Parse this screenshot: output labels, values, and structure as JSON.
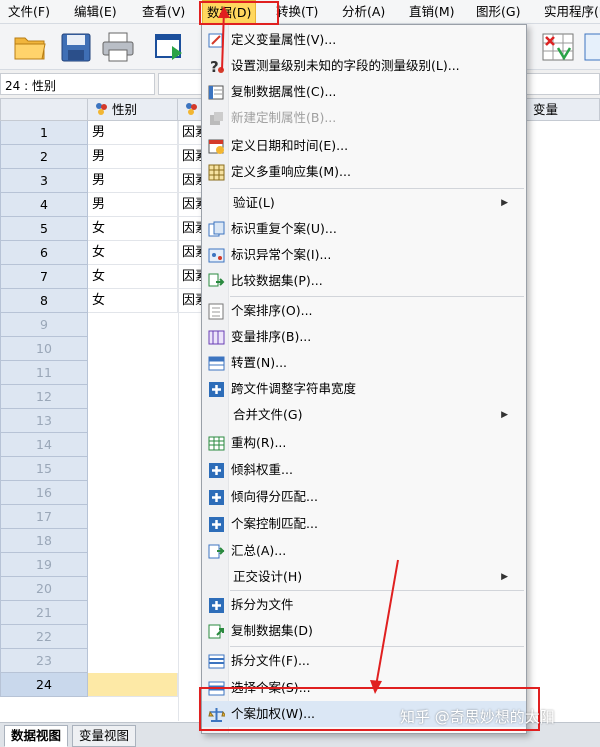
{
  "menubar": {
    "items": [
      {
        "label": "文件(F)"
      },
      {
        "label": "编辑(E)"
      },
      {
        "label": "查看(V)"
      },
      {
        "label": "数据(D)"
      },
      {
        "label": "转换(T)"
      },
      {
        "label": "分析(A)"
      },
      {
        "label": "直销(M)"
      },
      {
        "label": "图形(G)"
      },
      {
        "label": "实用程序(U)"
      }
    ]
  },
  "cellref": {
    "value": "24 : 性别"
  },
  "grid": {
    "columns": [
      "性别",
      "因素",
      "变量"
    ],
    "rows": [
      {
        "num": "1",
        "sex": "男",
        "factor": "因素"
      },
      {
        "num": "2",
        "sex": "男",
        "factor": "因素"
      },
      {
        "num": "3",
        "sex": "男",
        "factor": "因素"
      },
      {
        "num": "4",
        "sex": "男",
        "factor": "因素"
      },
      {
        "num": "5",
        "sex": "女",
        "factor": "因素"
      },
      {
        "num": "6",
        "sex": "女",
        "factor": "因素"
      },
      {
        "num": "7",
        "sex": "女",
        "factor": "因素"
      },
      {
        "num": "8",
        "sex": "女",
        "factor": "因素"
      }
    ],
    "empty_rows": [
      "9",
      "10",
      "11",
      "12",
      "13",
      "14",
      "15",
      "16",
      "17",
      "18",
      "19",
      "20",
      "21",
      "22",
      "23",
      "24"
    ]
  },
  "dropdown": {
    "items": [
      {
        "label": "定义变量属性(V)...",
        "icon": "define-var-icon"
      },
      {
        "label": "设置测量级别未知的字段的测量级别(L)...",
        "icon": "question-icon"
      },
      {
        "label": "复制数据属性(C)...",
        "icon": "copy-props-icon"
      },
      {
        "label": "新建定制属性(B)...",
        "icon": "custom-attr-icon",
        "disabled": true
      },
      {
        "label": "定义日期和时间(E)...",
        "icon": "calendar-icon"
      },
      {
        "label": "定义多重响应集(M)...",
        "icon": "grid-icon"
      },
      {
        "label": "验证(L)",
        "submenu": true
      },
      {
        "label": "标识重复个案(U)...",
        "icon": "duplicate-icon"
      },
      {
        "label": "标识异常个案(I)...",
        "icon": "unusual-icon"
      },
      {
        "label": "比较数据集(P)...",
        "icon": "compare-icon"
      },
      {
        "label": "个案排序(O)...",
        "icon": "sort-cases-icon"
      },
      {
        "label": "变量排序(B)...",
        "icon": "sort-vars-icon"
      },
      {
        "label": "转置(N)...",
        "icon": "transpose-icon"
      },
      {
        "label": "跨文件调整字符串宽度",
        "icon": "plus-icon"
      },
      {
        "label": "合并文件(G)",
        "submenu": true
      },
      {
        "label": "重构(R)...",
        "icon": "restructure-icon"
      },
      {
        "label": "倾斜权重...",
        "icon": "plus-icon"
      },
      {
        "label": "倾向得分匹配...",
        "icon": "plus-icon"
      },
      {
        "label": "个案控制匹配...",
        "icon": "plus-icon"
      },
      {
        "label": "汇总(A)...",
        "icon": "aggregate-icon"
      },
      {
        "label": "正交设计(H)",
        "submenu": true
      },
      {
        "label": "拆分为文件",
        "icon": "plus-icon"
      },
      {
        "label": "复制数据集(D)",
        "icon": "copy-dataset-icon"
      },
      {
        "label": "拆分文件(F)...",
        "icon": "split-file-icon"
      },
      {
        "label": "选择个案(S)...",
        "icon": "select-cases-icon"
      },
      {
        "label": "个案加权(W)...",
        "icon": "scale-icon"
      }
    ]
  },
  "tabs": {
    "data_view": "数据视图",
    "variable_view": "变量视图"
  },
  "watermark": "知乎 @奇思妙想的太阳",
  "colors": {
    "annotation": "#e02020",
    "menu_active": "#ffd75e",
    "row_header": "#dde6f2"
  }
}
